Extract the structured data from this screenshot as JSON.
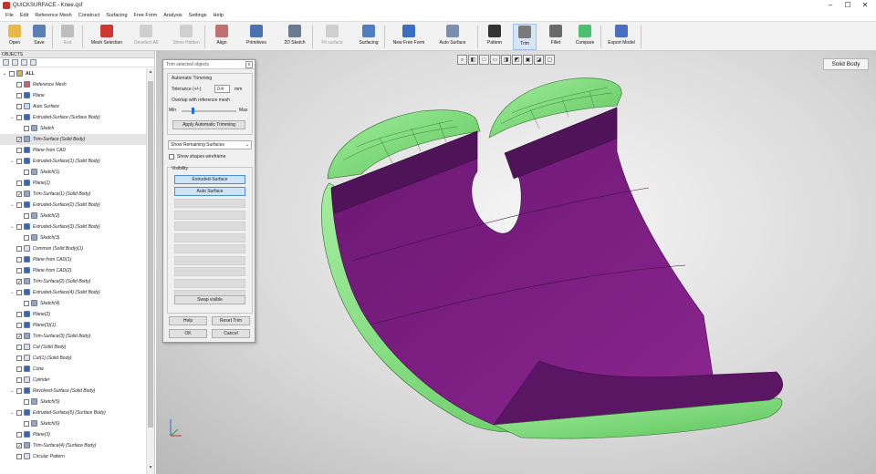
{
  "window": {
    "title": "QUICKSURFACE - Knee.qsf",
    "minimize": "–",
    "maximize": "☐",
    "close": "✕"
  },
  "menu": [
    "File",
    "Edit",
    "Reference Mesh",
    "Construct",
    "Surfacing",
    "Free Form",
    "Analysis",
    "Settings",
    "Help"
  ],
  "toolbar": [
    {
      "label": "Open",
      "icon": "folder-icon",
      "color": "#e8b84a",
      "enabled": true
    },
    {
      "label": "Save",
      "icon": "floppy-icon",
      "color": "#5a7fb8",
      "enabled": true
    },
    {
      "label": "Exit",
      "icon": "exit-icon",
      "color": "#bdbdbd",
      "enabled": false
    },
    {
      "label": "Mesh Selection",
      "icon": "mesh-selection-icon",
      "color": "#d0382f",
      "enabled": true
    },
    {
      "label": "Deselect All",
      "icon": "deselect-icon",
      "color": "#cfcfcf",
      "enabled": false
    },
    {
      "label": "Show Hidden",
      "icon": "eye-icon",
      "color": "#cfcfcf",
      "enabled": false
    },
    {
      "label": "Align",
      "icon": "align-icon",
      "color": "#c07070",
      "enabled": true
    },
    {
      "label": "Primitives",
      "icon": "primitives-icon",
      "color": "#4a72b0",
      "enabled": true
    },
    {
      "label": "2D Sketch",
      "icon": "sketch-icon",
      "color": "#6a7a90",
      "enabled": true
    },
    {
      "label": "Fit surface",
      "icon": "fit-surface-icon",
      "color": "#cfcfcf",
      "enabled": false
    },
    {
      "label": "Surfacing",
      "icon": "surfacing-icon",
      "color": "#4f7fc0",
      "enabled": true
    },
    {
      "label": "New Free Form",
      "icon": "freeform-icon",
      "color": "#3a6fc4",
      "enabled": true
    },
    {
      "label": "Auto Surface",
      "icon": "auto-surface-icon",
      "color": "#7a8fb0",
      "enabled": true
    },
    {
      "label": "Pattern",
      "icon": "pattern-icon",
      "color": "#333333",
      "enabled": true
    },
    {
      "label": "Trim",
      "icon": "trim-icon",
      "color": "#7a7a7a",
      "enabled": true
    },
    {
      "label": "Fillet",
      "icon": "fillet-icon",
      "color": "#6a6a6a",
      "enabled": true
    },
    {
      "label": "Compare",
      "icon": "compare-icon",
      "color": "#4cc070",
      "enabled": true
    },
    {
      "label": "Export Model",
      "icon": "export-icon",
      "color": "#4a6fc0",
      "enabled": true
    }
  ],
  "panel": {
    "header": "OBJECTS"
  },
  "tree": [
    {
      "label": "ALL",
      "icon": "folder-icon",
      "level": 0,
      "expand": "⌄",
      "checked": false,
      "color": "#d5b24a"
    },
    {
      "label": "Reference Mesh",
      "icon": "mesh-icon",
      "level": 1,
      "expand": "",
      "checked": false,
      "color": "#d06464"
    },
    {
      "label": "Plane",
      "icon": "plane-icon",
      "level": 1,
      "expand": "",
      "checked": false,
      "color": "#3a66b0"
    },
    {
      "label": "Auto Surface",
      "icon": "grid-icon",
      "level": 1,
      "expand": "",
      "checked": false,
      "color": "#c8d8ee"
    },
    {
      "label": "Extruded-Surface (Surface Body)",
      "icon": "extrude-icon",
      "level": 1,
      "expand": "⌄",
      "checked": false,
      "color": "#3a66b0"
    },
    {
      "label": "Sketch",
      "icon": "sketch-icon",
      "level": 2,
      "expand": "",
      "checked": false,
      "color": "#9aa6b8"
    },
    {
      "label": "Trim-Surface (Solid Body)",
      "icon": "solid-icon",
      "level": 1,
      "expand": "",
      "checked": true,
      "color": "#9aa6b8"
    },
    {
      "label": "Plane from CAD",
      "icon": "plane-icon",
      "level": 1,
      "expand": "",
      "checked": false,
      "color": "#3a66b0"
    },
    {
      "label": "Extruded-Surface(1) (Solid Body)",
      "icon": "extrude-icon",
      "level": 1,
      "expand": "⌄",
      "checked": false,
      "color": "#3a66b0"
    },
    {
      "label": "Sketch(1)",
      "icon": "sketch-icon",
      "level": 2,
      "expand": "",
      "checked": false,
      "color": "#9aa6b8"
    },
    {
      "label": "Plane(1)",
      "icon": "plane-icon",
      "level": 1,
      "expand": "",
      "checked": false,
      "color": "#3a66b0"
    },
    {
      "label": "Trim-Surface(1) (Solid Body)",
      "icon": "solid-icon",
      "level": 1,
      "expand": "",
      "checked": true,
      "color": "#9aa6b8"
    },
    {
      "label": "Extruded-Surface(2) (Solid Body)",
      "icon": "extrude-icon",
      "level": 1,
      "expand": "⌄",
      "checked": false,
      "color": "#3a66b0"
    },
    {
      "label": "Sketch(2)",
      "icon": "sketch-icon",
      "level": 2,
      "expand": "",
      "checked": false,
      "color": "#9aa6b8"
    },
    {
      "label": "Extruded-Surface(3) (Solid Body)",
      "icon": "extrude-icon",
      "level": 1,
      "expand": "⌄",
      "checked": false,
      "color": "#3a66b0"
    },
    {
      "label": "Sketch(3)",
      "icon": "sketch-icon",
      "level": 2,
      "expand": "",
      "checked": false,
      "color": "#9aa6b8"
    },
    {
      "label": "Common (Solid Body)(1)",
      "icon": "common-icon",
      "level": 1,
      "expand": "",
      "checked": false,
      "color": "#e0e0e0"
    },
    {
      "label": "Plane from CAD(1)",
      "icon": "plane-icon",
      "level": 1,
      "expand": "",
      "checked": false,
      "color": "#3a66b0"
    },
    {
      "label": "Plane from CAD(2)",
      "icon": "plane-icon",
      "level": 1,
      "expand": "",
      "checked": false,
      "color": "#3a66b0"
    },
    {
      "label": "Trim-Surface(2) (Solid Body)",
      "icon": "solid-icon",
      "level": 1,
      "expand": "",
      "checked": true,
      "color": "#9aa6b8"
    },
    {
      "label": "Extruded-Surface(4) (Solid Body)",
      "icon": "extrude-icon",
      "level": 1,
      "expand": "⌄",
      "checked": false,
      "color": "#3a66b0"
    },
    {
      "label": "Sketch(4)",
      "icon": "sketch-icon",
      "level": 2,
      "expand": "",
      "checked": false,
      "color": "#9aa6b8"
    },
    {
      "label": "Plane(2)",
      "icon": "plane-icon",
      "level": 1,
      "expand": "",
      "checked": false,
      "color": "#3a66b0"
    },
    {
      "label": "Plane(3)(1)",
      "icon": "plane-icon",
      "level": 1,
      "expand": "",
      "checked": false,
      "color": "#3a66b0"
    },
    {
      "label": "Trim-Surface(3) (Solid Body)",
      "icon": "solid-icon",
      "level": 1,
      "expand": "",
      "checked": true,
      "color": "#9aa6b8"
    },
    {
      "label": "Cut (Solid Body)",
      "icon": "cut-icon",
      "level": 1,
      "expand": "",
      "checked": false,
      "color": "#e0e0e0"
    },
    {
      "label": "Cut(1) (Solid Body)",
      "icon": "cut-icon",
      "level": 1,
      "expand": "",
      "checked": false,
      "color": "#e0e0e0"
    },
    {
      "label": "Cone",
      "icon": "cone-icon",
      "level": 1,
      "expand": "",
      "checked": false,
      "color": "#3a66b0"
    },
    {
      "label": "Cylinder",
      "icon": "cylinder-icon",
      "level": 1,
      "expand": "",
      "checked": false,
      "color": "#e0e0e0"
    },
    {
      "label": "Revolved-Surface (Solid Body)",
      "icon": "revolve-icon",
      "level": 1,
      "expand": "⌄",
      "checked": false,
      "color": "#3a66b0"
    },
    {
      "label": "Sketch(5)",
      "icon": "sketch-icon",
      "level": 2,
      "expand": "",
      "checked": false,
      "color": "#9aa6b8"
    },
    {
      "label": "Extruded-Surface(5) (Surface Body)",
      "icon": "extrude-icon",
      "level": 1,
      "expand": "⌄",
      "checked": false,
      "color": "#3a66b0"
    },
    {
      "label": "Sketch(6)",
      "icon": "sketch-icon",
      "level": 2,
      "expand": "",
      "checked": false,
      "color": "#9aa6b8"
    },
    {
      "label": "Plane(3)",
      "icon": "plane-icon",
      "level": 1,
      "expand": "",
      "checked": false,
      "color": "#3a66b0"
    },
    {
      "label": "Trim-Surface(4) (Surface Body)",
      "icon": "solid-icon",
      "level": 1,
      "expand": "",
      "checked": true,
      "color": "#9aa6b8"
    },
    {
      "label": "Circular Pattern",
      "icon": "pattern-icon",
      "level": 1,
      "expand": "",
      "checked": false,
      "color": "#e0e0e0"
    }
  ],
  "selected_tree_index": 6,
  "dialog": {
    "title": "Trim selected objects",
    "close": "x",
    "group_label": "Automatic Trimming",
    "tolerance_label": "Tolerance (+/-)",
    "tolerance_value": "0.4",
    "tolerance_unit": "mm",
    "overlap_label": "Overlap with reference mesh",
    "slider_min": "Min",
    "slider_max": "Max",
    "slider_level": 0.2,
    "apply_button": "Apply Automatic Trimming",
    "combo_value": "Show Remaining Surfaces",
    "wireframe_label": "Show shapes wireframe",
    "visibility_label": "Visibility",
    "visibility_buttons": [
      "Extruded-Surface",
      "Auto Surface"
    ],
    "empty_slots": 9,
    "swap_button": "Swap visible",
    "help_button": "Help",
    "reset_button": "Reset Trim",
    "ok_button": "OK",
    "cancel_button": "Cancel"
  },
  "viewport": {
    "mode_button": "Solid Body",
    "view_buttons": [
      "⌕",
      "◧",
      "□",
      "▭",
      "◨",
      "◩",
      "▣",
      "◪",
      "▢"
    ]
  },
  "colors": {
    "surface": "#7b1e80",
    "surface_dark": "#4f1358",
    "shell": "#7fe07f",
    "shell_dark": "#3f9a3f"
  }
}
